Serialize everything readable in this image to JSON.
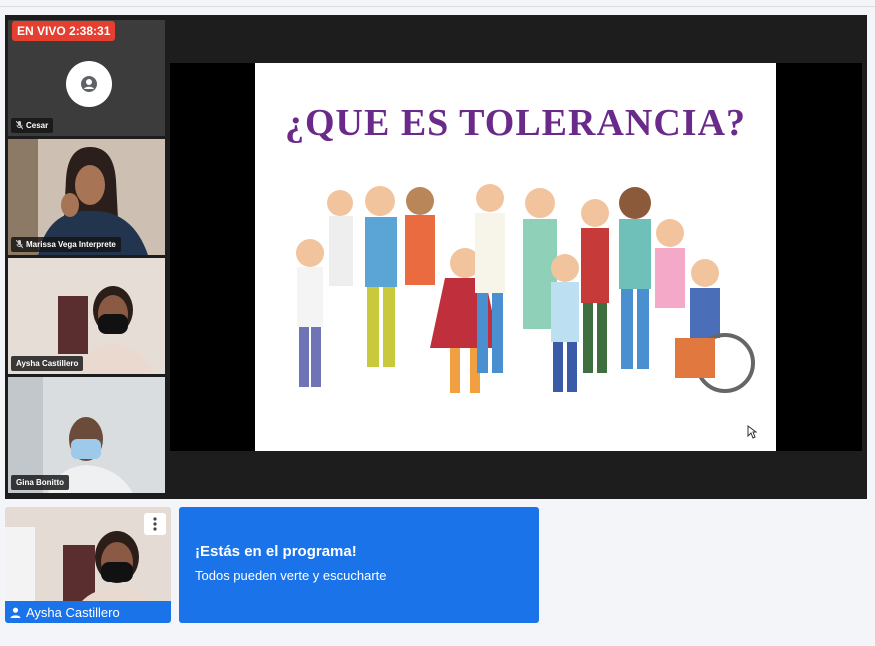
{
  "live_badge": "EN VIVO 2:38:31",
  "participants": [
    {
      "name": "Cesar",
      "muted": true,
      "camera": false
    },
    {
      "name": "Marissa Vega Interprete",
      "muted": true,
      "camera": true
    },
    {
      "name": "Aysha Castillero",
      "muted": false,
      "camera": true
    },
    {
      "name": "Gina Bonitto",
      "muted": false,
      "camera": true
    }
  ],
  "slide": {
    "title": "¿QUE ES TOLERANCIA?"
  },
  "self_view": {
    "name": "Aysha Castillero"
  },
  "banner": {
    "title": "¡Estás en el programa!",
    "subtitle": "Todos pueden verte y escucharte"
  },
  "icons": [
    "person-icon",
    "mic-off-icon",
    "more-vert-icon",
    "cursor-icon"
  ],
  "colors": {
    "live": "#e53f2f",
    "accent": "#1a73e8",
    "slide_title": "#6a2a8a"
  }
}
